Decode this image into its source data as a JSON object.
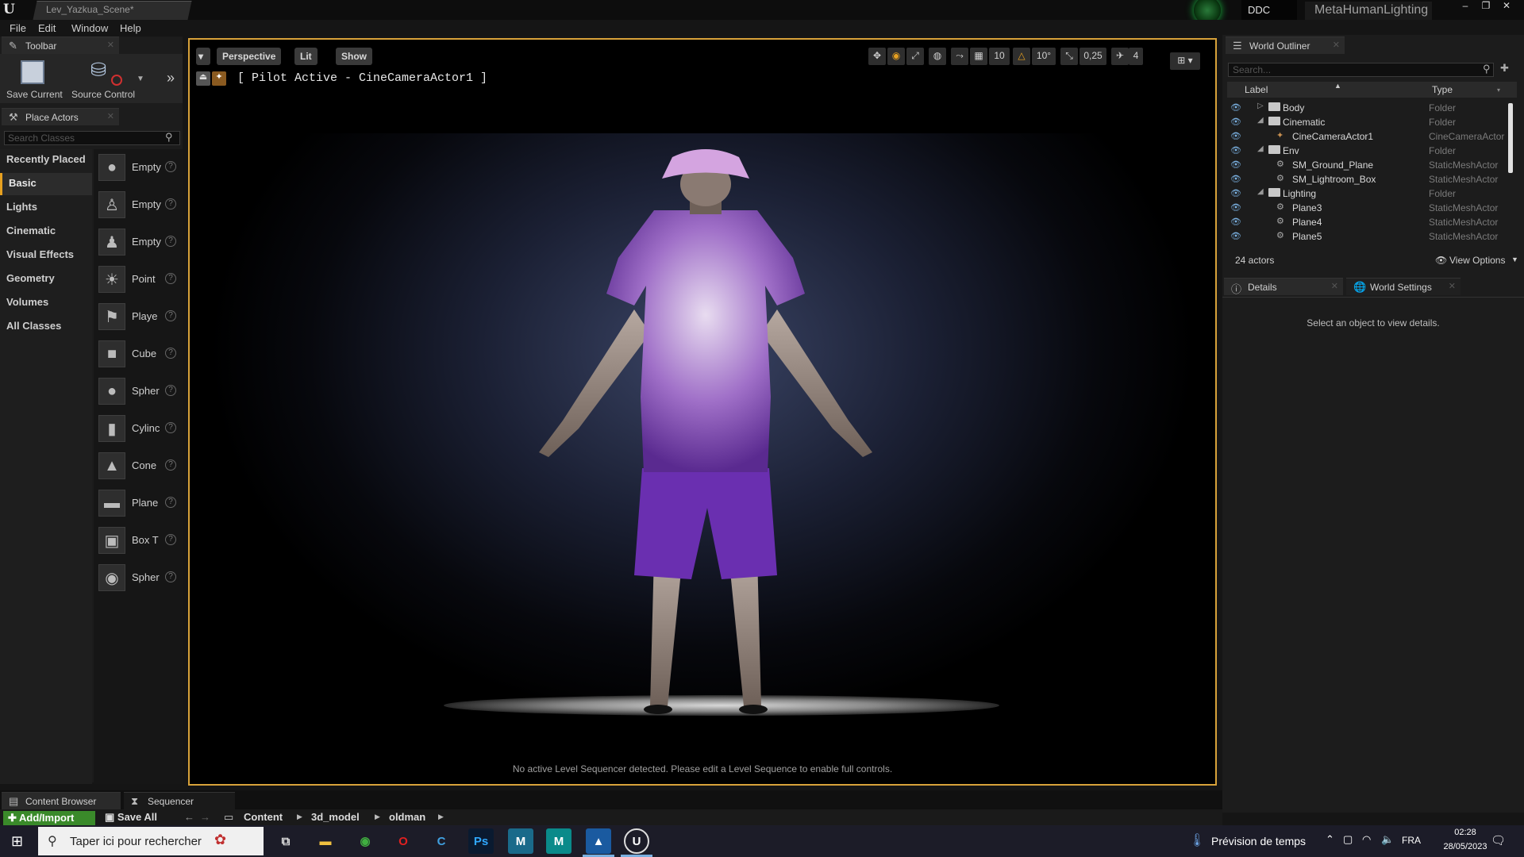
{
  "window": {
    "doc_tab": "Lev_Yazkua_Scene*",
    "ddc_label": "DDC",
    "project_name": "MetaHumanLighting"
  },
  "menu": [
    "File",
    "Edit",
    "Window",
    "Help"
  ],
  "toolbar_panel": {
    "title": "Toolbar",
    "save_label": "Save Current",
    "source_control_label": "Source Control"
  },
  "place_actors": {
    "title": "Place Actors",
    "search_placeholder": "Search Classes",
    "categories": [
      "Recently Placed",
      "Basic",
      "Lights",
      "Cinematic",
      "Visual Effects",
      "Geometry",
      "Volumes",
      "All Classes"
    ],
    "active_category": "Basic",
    "items": [
      "Empty",
      "Empty",
      "Empty",
      "Point",
      "Playe",
      "Cube",
      "Spher",
      "Cylinc",
      "Cone",
      "Plane",
      "Box T",
      "Spher"
    ]
  },
  "viewport": {
    "perspective_label": "Perspective",
    "lit_label": "Lit",
    "show_label": "Show",
    "grid_snap": "10",
    "rotation_snap": "10°",
    "scale_snap": "0,25",
    "camera_speed": "4",
    "pilot_label": "[ Pilot Active - CineCameraActor1 ]",
    "sequencer_message": "No active Level Sequencer detected. Please edit a Level Sequence to enable full controls."
  },
  "outliner": {
    "title": "World Outliner",
    "search_placeholder": "Search...",
    "col_label": "Label",
    "col_type": "Type",
    "rows": [
      {
        "name": "Body",
        "type": "Folder"
      },
      {
        "name": "Cinematic",
        "type": "Folder"
      },
      {
        "name": "CineCameraActor1",
        "type": "CineCameraActor"
      },
      {
        "name": "Env",
        "type": "Folder"
      },
      {
        "name": "SM_Ground_Plane",
        "type": "StaticMeshActor"
      },
      {
        "name": "SM_Lightroom_Box",
        "type": "StaticMeshActor"
      },
      {
        "name": "Lighting",
        "type": "Folder"
      },
      {
        "name": "Plane3",
        "type": "StaticMeshActor"
      },
      {
        "name": "Plane4",
        "type": "StaticMeshActor"
      },
      {
        "name": "Plane5",
        "type": "StaticMeshActor"
      }
    ],
    "actor_count": "24 actors",
    "view_options": "View Options"
  },
  "details": {
    "tab_details": "Details",
    "tab_world_settings": "World Settings",
    "empty_message": "Select an object to view details."
  },
  "bottom": {
    "tab_content_browser": "Content Browser",
    "tab_sequencer": "Sequencer",
    "add_import": "Add/Import",
    "save_all": "Save All",
    "breadcrumb": [
      "Content",
      "3d_model",
      "oldman"
    ]
  },
  "taskbar": {
    "search_placeholder": "Taper ici pour rechercher",
    "weather": "Prévision de temps",
    "language": "FRA",
    "time": "02:28",
    "date": "28/05/2023"
  },
  "colors": {
    "accent": "#d8a23a",
    "folder_outline_eye": "#7ab0e0",
    "add_button": "#3a8a2a"
  }
}
